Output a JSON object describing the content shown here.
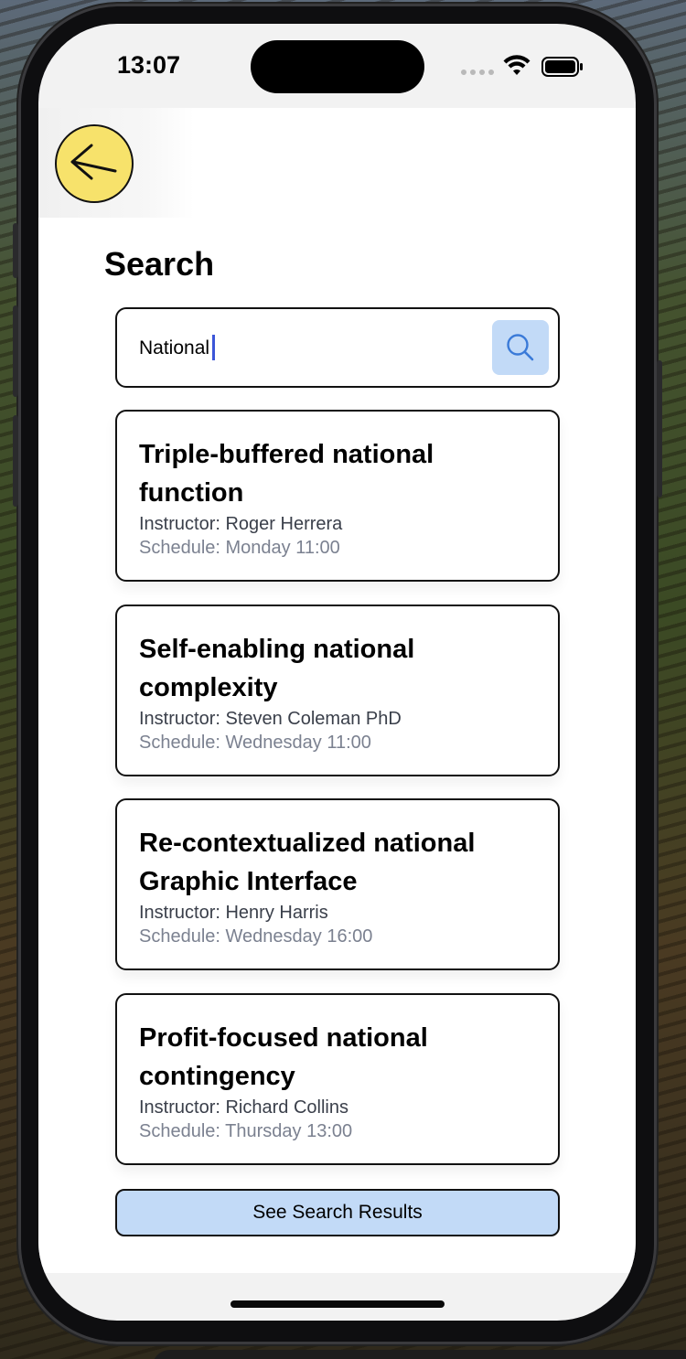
{
  "status_bar": {
    "time": "13:07"
  },
  "header": {
    "back_icon": "arrow-left-icon"
  },
  "page": {
    "title": "Search"
  },
  "search": {
    "value": "National",
    "button_icon": "search-icon"
  },
  "results": [
    {
      "title": "Triple-buffered national function",
      "instructor": "Instructor: Roger Herrera",
      "schedule": "Schedule: Monday 11:00"
    },
    {
      "title": "Self-enabling national complexity",
      "instructor": "Instructor: Steven Coleman PhD",
      "schedule": "Schedule: Wednesday 11:00"
    },
    {
      "title": "Re-contextualized national Graphic Interface",
      "instructor": "Instructor: Henry Harris",
      "schedule": "Schedule: Wednesday 16:00"
    },
    {
      "title": "Profit-focused national contingency",
      "instructor": "Instructor: Richard Collins",
      "schedule": "Schedule: Thursday 13:00"
    }
  ],
  "footer": {
    "results_button_label": "See Search Results"
  },
  "colors": {
    "accent_yellow": "#f7e26b",
    "accent_blue": "#c2daf7",
    "caret": "#3c56d8"
  }
}
